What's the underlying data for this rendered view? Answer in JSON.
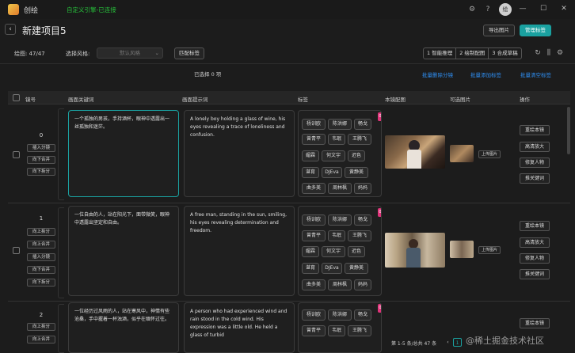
{
  "app": {
    "name": "创绘",
    "status": "自定义引擎-已连接",
    "avatar_text": "绘"
  },
  "title_icons": [
    "gear-icon",
    "help-icon"
  ],
  "window_buttons": {
    "minimize": "—",
    "maximize": "☐",
    "close": "✕"
  },
  "header": {
    "project_title": "新建项目5",
    "export_label": "导出图片",
    "manage_tags_label": "管理标签"
  },
  "toolbar": {
    "count_label": "绘图: 47/47",
    "style_label": "选择风格:",
    "style_placeholder": "默认风格",
    "match_tags_label": "匹配标签",
    "steps": [
      "1 智能推理",
      "2 绘制配图",
      "3 合成草稿"
    ]
  },
  "selection": {
    "text": "已选择  0  项"
  },
  "batch_links": [
    "批量删除分镜",
    "批量添加标签",
    "批量清空标签"
  ],
  "columns": [
    "镜号",
    "画面关键词",
    "画面提示词",
    "标签",
    "本镜配图",
    "可选图片",
    "操作"
  ],
  "tag_labels": [
    "杨训欧",
    "陈洪娜",
    "畅戈",
    "曾青平",
    "韦珉",
    "王腾飞",
    "媚霖",
    "何文宇",
    "迟色",
    "谌育",
    "DJEva",
    "黄静美",
    "曲多美",
    "周林枫",
    "妈妈"
  ],
  "rows": [
    {
      "index": "0",
      "side_buttons": [
        "插入分镜",
        "向下合并",
        "向下拆分"
      ],
      "keyword": "一个孤独的男孩，手持酒杯，眼神中透露出一丝孤独和迷茫。",
      "prompt": "A lonely boy holding a glass of wine, his eyes revealing a trace of loneliness and confusion.",
      "tag_count": "0",
      "upload_label": "上传图片",
      "actions": [
        "重绘本镜",
        "高清放大",
        "修复人物",
        "推关键词"
      ]
    },
    {
      "index": "1",
      "side_buttons": [
        "向上拆分",
        "向上合并",
        "插入分镜",
        "向下合并",
        "向下拆分"
      ],
      "keyword": "一位自由的人，站在阳光下，面带微笑，眼神中透露出坚定和自由。",
      "prompt": "A free man, standing in the sun, smiling, his eyes revealing determination and freedom.",
      "tag_count": "0",
      "upload_label": "上传图片",
      "actions": [
        "重绘本镜",
        "高清放大",
        "修复人物",
        "推关键词"
      ]
    },
    {
      "index": "2",
      "side_buttons": [
        "向上拆分",
        "向上合并"
      ],
      "keyword": "一位经历过风雨的人，站在寒风中，神情有些沧桑，手中握着一杯浊酒，似乎在缅怀过往。",
      "prompt": "A person who had experienced wind and rain stood in the cold wind. His expression was a little old. He held a glass of turbid",
      "tag_count": "0",
      "actions": [
        "重绘本镜"
      ]
    }
  ],
  "footer": {
    "info": "第 1-5 条/总共 47 条",
    "prev": "‹",
    "current_page": "1",
    "next": "›"
  },
  "watermark": "@稀土掘金技术社区"
}
